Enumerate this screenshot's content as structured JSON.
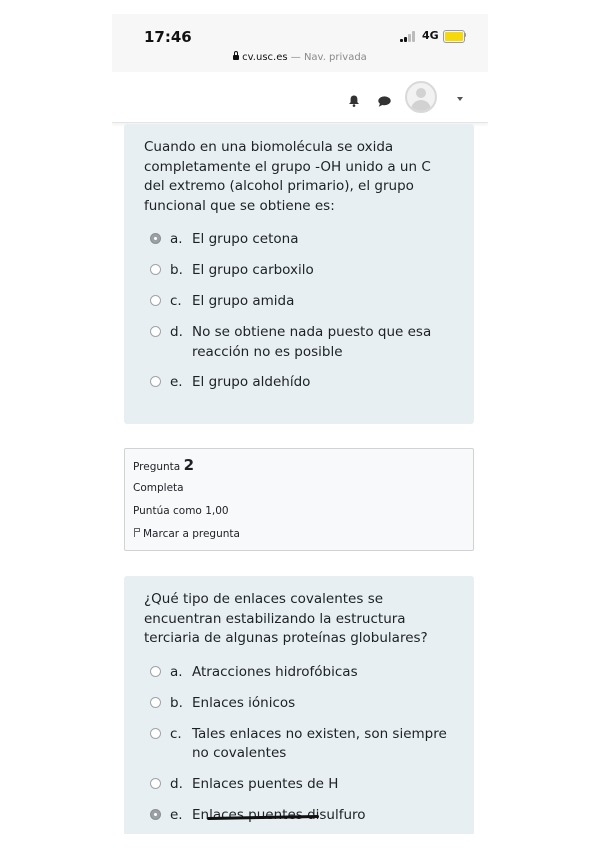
{
  "status_bar": {
    "time": "17:46",
    "network": "4G",
    "url": "cv.usc.es",
    "private_label": "— Nav. privada"
  },
  "navbar": {
    "icons": [
      "bell-icon",
      "chat-icon",
      "avatar",
      "caret-down-icon"
    ]
  },
  "question1": {
    "text": "Cuando en una biomolécula se oxida completamente el grupo -OH unido a un C del extremo (alcohol primario), el grupo funcional que se obtiene es:",
    "options": [
      {
        "letter": "a.",
        "text": "El grupo cetona",
        "selected": true
      },
      {
        "letter": "b.",
        "text": "El grupo carboxilo",
        "selected": false
      },
      {
        "letter": "c.",
        "text": "El grupo amida",
        "selected": false
      },
      {
        "letter": "d.",
        "text": "No se obtiene nada puesto que esa reacción no es posible",
        "selected": false
      },
      {
        "letter": "e.",
        "text": "El grupo aldehído",
        "selected": false
      }
    ]
  },
  "question2_info": {
    "label": "Pregunta",
    "number": "2",
    "status": "Completa",
    "score": "Puntúa como 1,00",
    "flag_label": "Marcar a pregunta"
  },
  "question2": {
    "text": "¿Qué tipo de enlaces covalentes se encuentran estabilizando la estructura terciaria de algunas proteínas globulares?",
    "options": [
      {
        "letter": "a.",
        "text": "Atracciones hidrofóbicas",
        "selected": false
      },
      {
        "letter": "b.",
        "text": "Enlaces iónicos",
        "selected": false
      },
      {
        "letter": "c.",
        "text": "Tales enlaces no existen, son siempre no covalentes",
        "selected": false
      },
      {
        "letter": "d.",
        "text": "Enlaces puentes de H",
        "selected": false
      },
      {
        "letter": "e.",
        "text": "Enlaces puentes disulfuro",
        "selected": true
      }
    ]
  },
  "colors": {
    "card_bg": "#e7eff2",
    "battery": "#f5d90a",
    "text": "#1d2125"
  }
}
